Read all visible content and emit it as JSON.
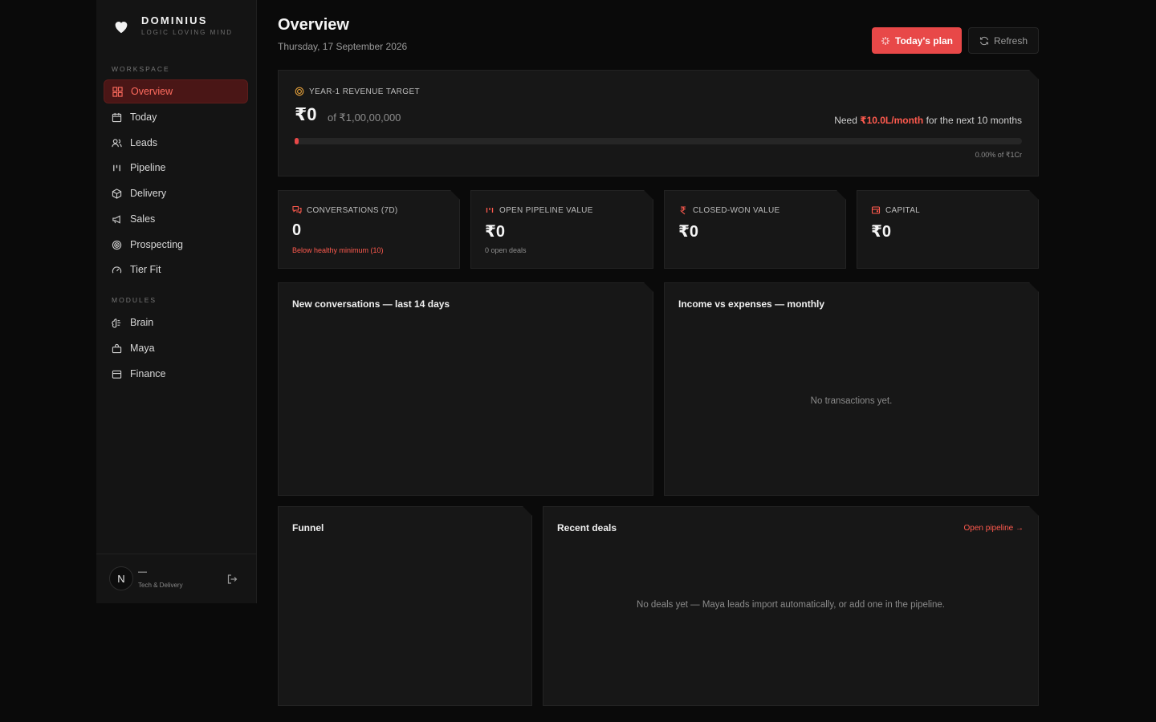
{
  "brand": {
    "name": "DOMINIUS",
    "tagline": "LOGIC LOVING MIND"
  },
  "sidebar": {
    "workspace_label": "WORKSPACE",
    "workspace_items": [
      {
        "label": "Overview",
        "icon": "grid-icon",
        "active": true
      },
      {
        "label": "Today",
        "icon": "calendar-icon"
      },
      {
        "label": "Leads",
        "icon": "users-icon"
      },
      {
        "label": "Pipeline",
        "icon": "bars-icon"
      },
      {
        "label": "Delivery",
        "icon": "package-icon"
      },
      {
        "label": "Sales",
        "icon": "megaphone-icon"
      },
      {
        "label": "Prospecting",
        "icon": "target-icon"
      },
      {
        "label": "Tier Fit",
        "icon": "gauge-icon"
      }
    ],
    "modules_label": "MODULES",
    "module_items": [
      {
        "label": "Brain",
        "icon": "brain-icon"
      },
      {
        "label": "Maya",
        "icon": "bag-icon"
      },
      {
        "label": "Finance",
        "icon": "wallet-icon"
      }
    ],
    "user": {
      "initial": "N",
      "name": "—",
      "role": "Tech & Delivery"
    }
  },
  "header": {
    "title": "Overview",
    "date": "Thursday, 17 September 2026",
    "plan_button": "Today's plan",
    "refresh_button": "Refresh"
  },
  "revenue": {
    "label": "YEAR-1 REVENUE TARGET",
    "value": "₹0",
    "of": "of ₹1,00,00,000",
    "need_prefix": "Need",
    "need_amount": "₹10.0L/month",
    "need_suffix": "for the next 10 months",
    "progress_fraction": 0.0,
    "percent_text": "0.00% of ₹1Cr"
  },
  "stats": [
    {
      "label": "CONVERSATIONS (7D)",
      "value": "0",
      "sub": "Below healthy minimum (10)",
      "sub_warn": true,
      "icon": "chat-icon"
    },
    {
      "label": "OPEN PIPELINE VALUE",
      "value": "₹0",
      "sub": "0 open deals",
      "sub_warn": false,
      "icon": "bars-icon"
    },
    {
      "label": "CLOSED-WON VALUE",
      "value": "₹0",
      "sub": "",
      "sub_warn": false,
      "icon": "rupee-icon"
    },
    {
      "label": "CAPITAL",
      "value": "₹0",
      "sub": "",
      "sub_warn": false,
      "icon": "wallet-icon"
    }
  ],
  "panels": {
    "conversations": {
      "title": "New conversations — last 14 days"
    },
    "income": {
      "title": "Income vs expenses — monthly",
      "empty": "No transactions yet."
    },
    "funnel": {
      "title": "Funnel"
    },
    "deals": {
      "title": "Recent deals",
      "link": "Open pipeline →",
      "empty": "No deals yet — Maya leads import automatically, or add one in the pipeline."
    }
  },
  "colors": {
    "accent": "#e84848",
    "accent_text": "#ff5a4e",
    "active_bg": "#4a1616"
  }
}
